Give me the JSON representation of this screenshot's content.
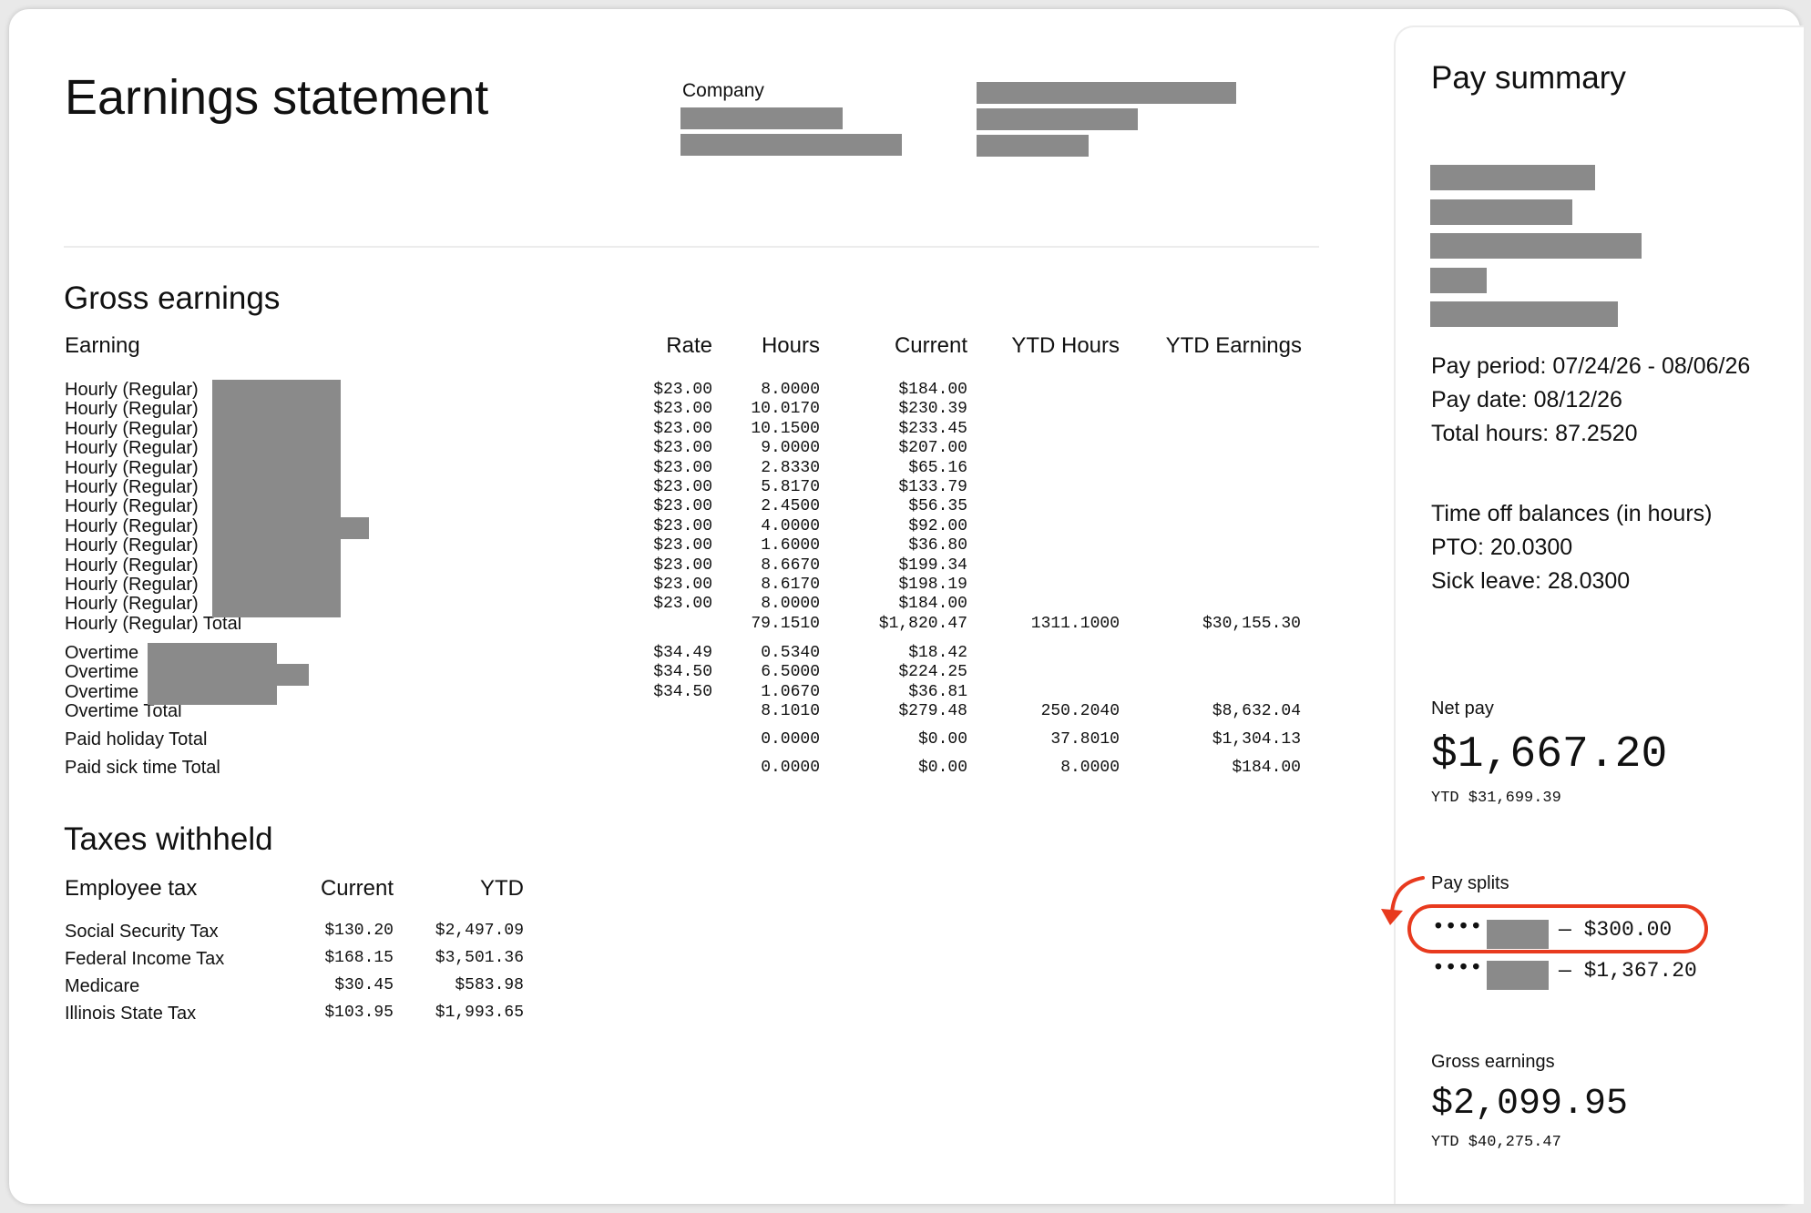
{
  "header": {
    "title": "Earnings statement",
    "company_label": "Company"
  },
  "gross_earnings": {
    "heading": "Gross earnings",
    "columns": [
      "Earning",
      "Rate",
      "Hours",
      "Current",
      "YTD Hours",
      "YTD Earnings"
    ],
    "hourly_label": "Hourly (Regular)",
    "hourly_rows": [
      {
        "rate": "$23.00",
        "hours": "8.0000",
        "current": "$184.00"
      },
      {
        "rate": "$23.00",
        "hours": "10.0170",
        "current": "$230.39"
      },
      {
        "rate": "$23.00",
        "hours": "10.1500",
        "current": "$233.45"
      },
      {
        "rate": "$23.00",
        "hours": "9.0000",
        "current": "$207.00"
      },
      {
        "rate": "$23.00",
        "hours": "2.8330",
        "current": "$65.16"
      },
      {
        "rate": "$23.00",
        "hours": "5.8170",
        "current": "$133.79"
      },
      {
        "rate": "$23.00",
        "hours": "2.4500",
        "current": "$56.35"
      },
      {
        "rate": "$23.00",
        "hours": "4.0000",
        "current": "$92.00"
      },
      {
        "rate": "$23.00",
        "hours": "1.6000",
        "current": "$36.80"
      },
      {
        "rate": "$23.00",
        "hours": "8.6670",
        "current": "$199.34"
      },
      {
        "rate": "$23.00",
        "hours": "8.6170",
        "current": "$198.19"
      },
      {
        "rate": "$23.00",
        "hours": "8.0000",
        "current": "$184.00"
      }
    ],
    "hourly_total": {
      "label": "Hourly (Regular) Total",
      "hours": "79.1510",
      "current": "$1,820.47",
      "ytd_hours": "1311.1000",
      "ytd_earnings": "$30,155.30"
    },
    "overtime_label": "Overtime",
    "overtime_rows": [
      {
        "rate": "$34.49",
        "hours": "0.5340",
        "current": "$18.42"
      },
      {
        "rate": "$34.50",
        "hours": "6.5000",
        "current": "$224.25"
      },
      {
        "rate": "$34.50",
        "hours": "1.0670",
        "current": "$36.81"
      }
    ],
    "overtime_total": {
      "label": "Overtime Total",
      "hours": "8.1010",
      "current": "$279.48",
      "ytd_hours": "250.2040",
      "ytd_earnings": "$8,632.04"
    },
    "holiday_total": {
      "label": "Paid holiday Total",
      "hours": "0.0000",
      "current": "$0.00",
      "ytd_hours": "37.8010",
      "ytd_earnings": "$1,304.13"
    },
    "sick_total": {
      "label": "Paid sick time Total",
      "hours": "0.0000",
      "current": "$0.00",
      "ytd_hours": "8.0000",
      "ytd_earnings": "$184.00"
    }
  },
  "taxes": {
    "heading": "Taxes withheld",
    "columns": [
      "Employee tax",
      "Current",
      "YTD"
    ],
    "rows": [
      {
        "name": "Social Security Tax",
        "current": "$130.20",
        "ytd": "$2,497.09"
      },
      {
        "name": "Federal Income Tax",
        "current": "$168.15",
        "ytd": "$3,501.36"
      },
      {
        "name": "Medicare",
        "current": "$30.45",
        "ytd": "$583.98"
      },
      {
        "name": "Illinois State Tax",
        "current": "$103.95",
        "ytd": "$1,993.65"
      }
    ]
  },
  "pay_summary": {
    "heading": "Pay summary",
    "pay_period": "Pay period: 07/24/26 - 08/06/26",
    "pay_date": "Pay date: 08/12/26",
    "total_hours": "Total hours: 87.2520",
    "time_off_heading": "Time off balances (in hours)",
    "pto": "PTO: 20.0300",
    "sick_leave": "Sick leave: 28.0300",
    "net_pay_label": "Net pay",
    "net_pay": "$1,667.20",
    "net_pay_ytd": "YTD $31,699.39",
    "pay_splits_label": "Pay splits",
    "splits": [
      {
        "mask": "••••",
        "amount": "— $300.00"
      },
      {
        "mask": "••••",
        "amount": "— $1,367.20"
      }
    ],
    "gross_label": "Gross earnings",
    "gross": "$2,099.95",
    "gross_ytd": "YTD $40,275.47"
  },
  "colors": {
    "highlight": "#e83a1e",
    "redaction": "#8a8a8a"
  }
}
